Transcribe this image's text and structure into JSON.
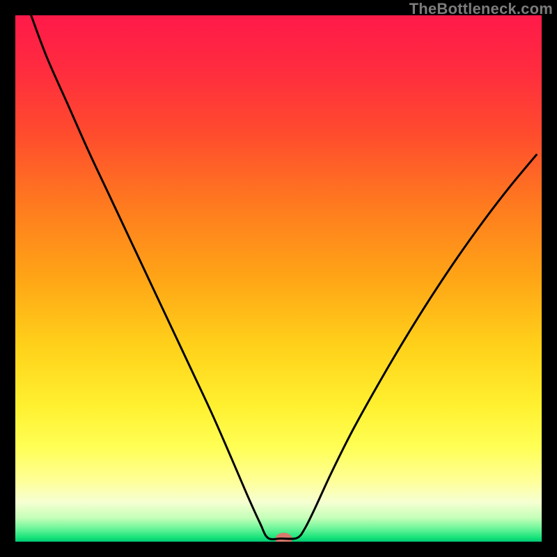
{
  "attribution": "TheBottleneck.com",
  "colors": {
    "curve": "#000000",
    "marker": "#d9786d",
    "page_bg": "#000000"
  },
  "gradient_stops": [
    {
      "offset": 0.0,
      "color": "#ff1a49"
    },
    {
      "offset": 0.1,
      "color": "#ff2b3f"
    },
    {
      "offset": 0.22,
      "color": "#ff4a2e"
    },
    {
      "offset": 0.36,
      "color": "#ff7a1f"
    },
    {
      "offset": 0.5,
      "color": "#ffa516"
    },
    {
      "offset": 0.63,
      "color": "#ffd21a"
    },
    {
      "offset": 0.74,
      "color": "#fff02f"
    },
    {
      "offset": 0.82,
      "color": "#ffff55"
    },
    {
      "offset": 0.885,
      "color": "#ffff99"
    },
    {
      "offset": 0.925,
      "color": "#f6ffd2"
    },
    {
      "offset": 0.955,
      "color": "#c4ffb8"
    },
    {
      "offset": 0.975,
      "color": "#6cf59a"
    },
    {
      "offset": 0.992,
      "color": "#18e37a"
    },
    {
      "offset": 1.0,
      "color": "#00c974"
    }
  ],
  "chart_data": {
    "type": "line",
    "title": "",
    "xlabel": "",
    "ylabel": "",
    "xlim": [
      0,
      100
    ],
    "ylim": [
      0,
      100
    ],
    "marker": {
      "x": 51.0,
      "y": 0.5,
      "rx": 1.6,
      "ry": 1.2
    },
    "series": [
      {
        "name": "bottleneck-curve",
        "x": [
          3.0,
          6.0,
          10.0,
          14.0,
          18.0,
          22.0,
          26.0,
          30.0,
          34.0,
          37.5,
          41.0,
          44.0,
          46.5,
          48.0,
          50.5,
          53.5,
          55.0,
          57.0,
          60.0,
          64.0,
          69.0,
          74.0,
          79.0,
          84.0,
          89.0,
          94.0,
          99.0
        ],
        "y": [
          100.0,
          92.0,
          83.0,
          74.0,
          65.5,
          57.0,
          48.5,
          40.0,
          31.5,
          24.0,
          16.0,
          9.0,
          3.5,
          0.7,
          0.6,
          0.7,
          2.5,
          6.5,
          13.0,
          21.0,
          30.0,
          38.5,
          46.5,
          54.0,
          61.0,
          67.5,
          73.5
        ]
      }
    ]
  }
}
